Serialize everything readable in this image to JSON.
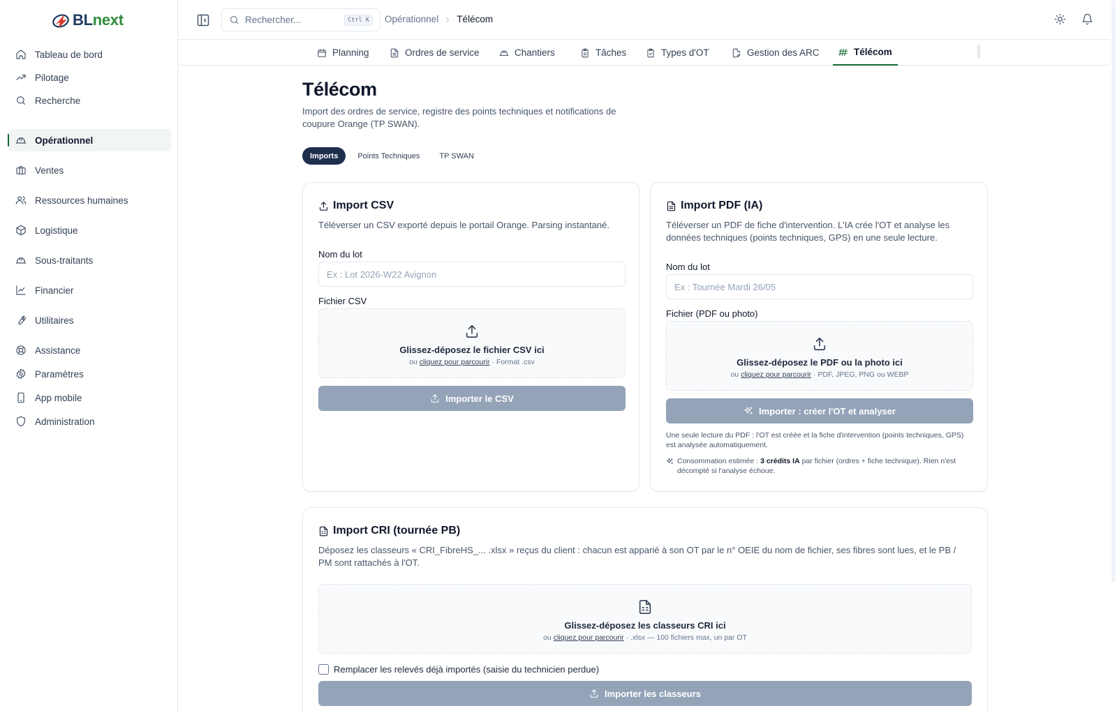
{
  "app": {
    "logo_prefix": "BL",
    "logo_suffix": "next"
  },
  "sidebar": {
    "items": [
      {
        "label": "Tableau de bord",
        "icon": "home-icon"
      },
      {
        "label": "Pilotage",
        "icon": "trending-up-icon"
      },
      {
        "label": "Recherche",
        "icon": "search-icon"
      },
      {
        "label": "Opérationnel",
        "icon": "hard-hat-icon",
        "active": true
      },
      {
        "label": "Ventes",
        "icon": "briefcase-icon"
      },
      {
        "label": "Ressources humaines",
        "icon": "users-icon"
      },
      {
        "label": "Logistique",
        "icon": "package-icon"
      },
      {
        "label": "Sous-traitants",
        "icon": "hard-hat-icon"
      },
      {
        "label": "Financier",
        "icon": "line-chart-icon"
      },
      {
        "label": "Utilitaires",
        "icon": "wrench-icon"
      },
      {
        "label": "Assistance",
        "icon": "life-buoy-icon"
      },
      {
        "label": "Paramètres",
        "icon": "gear-icon"
      },
      {
        "label": "App mobile",
        "icon": "smartphone-icon"
      },
      {
        "label": "Administration",
        "icon": "shield-icon"
      }
    ]
  },
  "topbar": {
    "search_placeholder": "Rechercher...",
    "search_shortcut": "Ctrl K",
    "breadcrumb": [
      "Opérationnel",
      "Télécom"
    ]
  },
  "tabs": [
    {
      "label": "Planning",
      "icon": "calendar-icon"
    },
    {
      "label": "Ordres de service",
      "icon": "file-text-icon"
    },
    {
      "label": "Chantiers",
      "icon": "hard-hat-icon"
    },
    {
      "label": "Tâches",
      "icon": "clipboard-icon"
    },
    {
      "label": "Types d'OT",
      "icon": "clipboard-check-icon"
    },
    {
      "label": "Gestion des ARC",
      "icon": "file-edit-icon"
    },
    {
      "label": "Télécom",
      "icon": "antenna-icon",
      "active": true
    }
  ],
  "page": {
    "title": "Télécom",
    "subtitle": "Import des ordres de service, registre des points techniques et notifications de coupure Orange (TP SWAN).",
    "subtabs": [
      {
        "label": "Imports",
        "active": true
      },
      {
        "label": "Points Techniques"
      },
      {
        "label": "TP SWAN"
      }
    ]
  },
  "csv_card": {
    "title": "Import CSV",
    "description": "Téléverser un CSV exporté depuis le portail Orange. Parsing instantané.",
    "batch_label": "Nom du lot",
    "batch_placeholder": "Ex : Lot 2026-W22 Avignon",
    "file_label": "Fichier CSV",
    "drop_main": "Glissez-déposez le fichier CSV ici",
    "drop_or": "ou",
    "drop_link": "cliquez pour parcourir",
    "drop_hint": "· Format .csv",
    "button": "Importer le CSV"
  },
  "pdf_card": {
    "title": "Import PDF (IA)",
    "description": "Téléverser un PDF de fiche d'intervention. L'IA crée l'OT et analyse les données techniques (points techniques, GPS) en une seule lecture.",
    "batch_label": "Nom du lot",
    "batch_placeholder": "Ex : Tournée Mardi 26/05",
    "file_label": "Fichier (PDF ou photo)",
    "drop_main": "Glissez-déposez le PDF ou la photo ici",
    "drop_or": "ou",
    "drop_link": "cliquez pour parcourir",
    "drop_hint": "· PDF, JPEG, PNG ou WEBP",
    "button": "Importer : créer l'OT et analyser",
    "note": "Une seule lecture du PDF : l'OT est créée et la fiche d'intervention (points techniques, GPS) est analysée automatiquement.",
    "cost_prefix": "Consommation estimée :",
    "cost_value": "3 crédits IA",
    "cost_suffix": "par fichier (ordres + fiche technique). Rien n'est décompté si l'analyse échoue."
  },
  "cri_card": {
    "title": "Import CRI (tournée PB)",
    "description": "Déposez les classeurs « CRI_FibreHS_... .xlsx » reçus du client : chacun est apparié à son OT par le n° OEIE du nom de fichier, ses fibres sont lues, et le PB / PM sont rattachés à l'OT.",
    "drop_main": "Glissez-déposez les classeurs CRI ici",
    "drop_or": "ou",
    "drop_link": "cliquez pour parcourir",
    "drop_hint": "· .xlsx — 100 fichiers max, un par OT",
    "checkbox_label": "Remplacer les relevés déjà importés (saisie du technicien perdue)",
    "checkbox_checked": false,
    "button": "Importer les classeurs"
  },
  "colors": {
    "accent_green": "#166534",
    "logo_navy": "#1e3a5f",
    "logo_green": "#2e8b3a",
    "pill_active": "#1e2f4d",
    "button_disabled": "#94a3b8"
  }
}
